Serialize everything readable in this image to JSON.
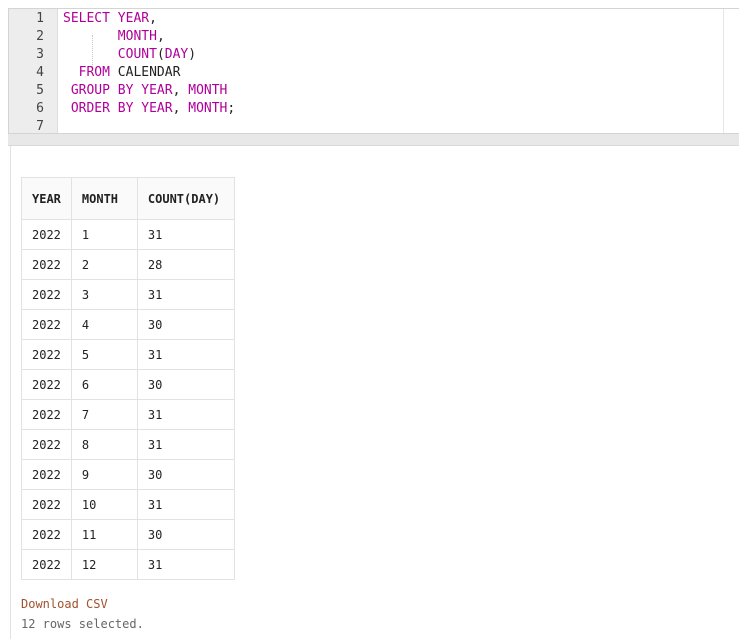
{
  "editor": {
    "line_numbers": [
      "1",
      "2",
      "3",
      "4",
      "5",
      "6",
      "7"
    ],
    "lines": [
      [
        {
          "t": "kw",
          "v": "SELECT"
        },
        {
          "t": "plain",
          "v": " "
        },
        {
          "t": "id",
          "v": "YEAR"
        },
        {
          "t": "plain",
          "v": ","
        }
      ],
      [
        {
          "t": "plain",
          "v": "       "
        },
        {
          "t": "id",
          "v": "MONTH"
        },
        {
          "t": "plain",
          "v": ","
        }
      ],
      [
        {
          "t": "plain",
          "v": "       "
        },
        {
          "t": "id",
          "v": "COUNT"
        },
        {
          "t": "plain",
          "v": "("
        },
        {
          "t": "id",
          "v": "DAY"
        },
        {
          "t": "plain",
          "v": ")"
        }
      ],
      [
        {
          "t": "plain",
          "v": "  "
        },
        {
          "t": "kw",
          "v": "FROM"
        },
        {
          "t": "plain",
          "v": " CALENDAR"
        }
      ],
      [
        {
          "t": "plain",
          "v": " "
        },
        {
          "t": "kw",
          "v": "GROUP BY"
        },
        {
          "t": "plain",
          "v": " "
        },
        {
          "t": "id",
          "v": "YEAR"
        },
        {
          "t": "plain",
          "v": ", "
        },
        {
          "t": "id",
          "v": "MONTH"
        }
      ],
      [
        {
          "t": "plain",
          "v": " "
        },
        {
          "t": "kw",
          "v": "ORDER BY"
        },
        {
          "t": "plain",
          "v": " "
        },
        {
          "t": "id",
          "v": "YEAR"
        },
        {
          "t": "plain",
          "v": ", "
        },
        {
          "t": "id",
          "v": "MONTH"
        },
        {
          "t": "plain",
          "v": ";"
        }
      ],
      []
    ]
  },
  "results": {
    "columns": [
      "YEAR",
      "MONTH",
      "COUNT(DAY)"
    ],
    "rows": [
      [
        "2022",
        "1",
        "31"
      ],
      [
        "2022",
        "2",
        "28"
      ],
      [
        "2022",
        "3",
        "31"
      ],
      [
        "2022",
        "4",
        "30"
      ],
      [
        "2022",
        "5",
        "31"
      ],
      [
        "2022",
        "6",
        "30"
      ],
      [
        "2022",
        "7",
        "31"
      ],
      [
        "2022",
        "8",
        "31"
      ],
      [
        "2022",
        "9",
        "30"
      ],
      [
        "2022",
        "10",
        "31"
      ],
      [
        "2022",
        "11",
        "30"
      ],
      [
        "2022",
        "12",
        "31"
      ]
    ],
    "download_label": "Download CSV",
    "status_text": "12 rows selected."
  }
}
